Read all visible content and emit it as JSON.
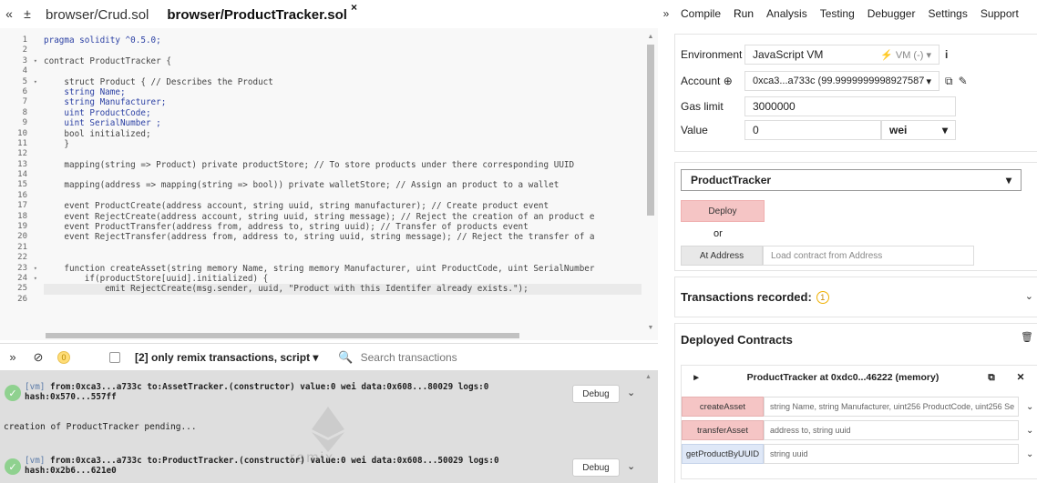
{
  "tabs": [
    {
      "label": "browser/Crud.sol"
    },
    {
      "label": "browser/ProductTracker.sol",
      "close": "×"
    }
  ],
  "nav_icons": {
    "left": "«",
    "add": "±"
  },
  "editor": {
    "lines": [
      {
        "n": "1",
        "fold": "",
        "text": "pragma solidity ^0.5.0;",
        "cls": "kw"
      },
      {
        "n": "2",
        "fold": "",
        "text": "",
        "cls": ""
      },
      {
        "n": "3",
        "fold": "▾",
        "text": "contract ProductTracker {",
        "cls": ""
      },
      {
        "n": "4",
        "fold": "",
        "text": "",
        "cls": ""
      },
      {
        "n": "5",
        "fold": "▾",
        "text": "    struct Product { // Describes the Product",
        "cls": ""
      },
      {
        "n": "6",
        "fold": "",
        "text": "    string Name;",
        "cls": "kw"
      },
      {
        "n": "7",
        "fold": "",
        "text": "    string Manufacturer;",
        "cls": "kw"
      },
      {
        "n": "8",
        "fold": "",
        "text": "    uint ProductCode;",
        "cls": "kw"
      },
      {
        "n": "9",
        "fold": "",
        "text": "    uint SerialNumber ;",
        "cls": "kw"
      },
      {
        "n": "10",
        "fold": "",
        "text": "    bool initialized;",
        "cls": ""
      },
      {
        "n": "11",
        "fold": "",
        "text": "    }",
        "cls": ""
      },
      {
        "n": "12",
        "fold": "",
        "text": "",
        "cls": ""
      },
      {
        "n": "13",
        "fold": "",
        "text": "    mapping(string => Product) private productStore; // To store products under there corresponding UUID",
        "cls": ""
      },
      {
        "n": "14",
        "fold": "",
        "text": "",
        "cls": ""
      },
      {
        "n": "15",
        "fold": "",
        "text": "    mapping(address => mapping(string => bool)) private walletStore; // Assign an product to a wallet",
        "cls": ""
      },
      {
        "n": "16",
        "fold": "",
        "text": "",
        "cls": ""
      },
      {
        "n": "17",
        "fold": "",
        "text": "    event ProductCreate(address account, string uuid, string manufacturer); // Create product event",
        "cls": ""
      },
      {
        "n": "18",
        "fold": "",
        "text": "    event RejectCreate(address account, string uuid, string message); // Reject the creation of an product e",
        "cls": ""
      },
      {
        "n": "19",
        "fold": "",
        "text": "    event ProductTransfer(address from, address to, string uuid); // Transfer of products event",
        "cls": ""
      },
      {
        "n": "20",
        "fold": "",
        "text": "    event RejectTransfer(address from, address to, string uuid, string message); // Reject the transfer of a",
        "cls": ""
      },
      {
        "n": "21",
        "fold": "",
        "text": "",
        "cls": ""
      },
      {
        "n": "22",
        "fold": "",
        "text": "",
        "cls": ""
      },
      {
        "n": "23",
        "fold": "▾",
        "text": "    function createAsset(string memory Name, string memory Manufacturer, uint ProductCode, uint SerialNumber",
        "cls": ""
      },
      {
        "n": "24",
        "fold": "▾",
        "text": "        if(productStore[uuid].initialized) {",
        "cls": ""
      },
      {
        "n": "25",
        "fold": "",
        "text": "            emit RejectCreate(msg.sender, uuid, \"Product with this Identifer already exists.\");",
        "cls": "caret"
      },
      {
        "n": "26",
        "fold": "",
        "text": "",
        "cls": ""
      }
    ]
  },
  "terminal_bar": {
    "collapse_icon": "chevron-double-down-icon",
    "clear_icon": "ban-icon",
    "pending_count": "0",
    "filter_label": "[2] only remix transactions, script",
    "search_placeholder": "Search transactions"
  },
  "terminal": {
    "tx1": {
      "tag": "[vm]",
      "line1": "from:0xca3...a733c to:AssetTracker.(constructor) value:0 wei data:0x608...80029 logs:0",
      "line2": "hash:0x570...557ff"
    },
    "pending": "creation of ProductTracker pending...",
    "tx2": {
      "tag": "[vm]",
      "line1": "from:0xca3...a733c to:ProductTracker.(constructor) value:0 wei data:0x608...50029 logs:0",
      "line2": "hash:0x2b6...621e0"
    },
    "debug_label": "Debug",
    "watermark": "remix"
  },
  "right_tabs": [
    "Compile",
    "Run",
    "Analysis",
    "Testing",
    "Debugger",
    "Settings",
    "Support"
  ],
  "run": {
    "environment_label": "Environment",
    "environment_value": "JavaScript VM",
    "vm_label": "VM (-)",
    "account_label": "Account",
    "account_value": "0xca3...a733c (99.9999999998927587",
    "gas_label": "Gas limit",
    "gas_value": "3000000",
    "value_label": "Value",
    "value_value": "0",
    "value_unit": "wei"
  },
  "deploy": {
    "contract": "ProductTracker",
    "deploy_label": "Deploy",
    "or_label": "or",
    "at_address_label": "At Address",
    "at_address_placeholder": "Load contract from Address"
  },
  "transactions": {
    "label": "Transactions recorded:",
    "count": "1"
  },
  "deployed": {
    "label": "Deployed Contracts",
    "instance": "ProductTracker at 0xdc0...46222 (memory)",
    "functions": [
      {
        "name": "createAsset",
        "params": "string Name, string Manufacturer, uint256 ProductCode, uint256 Se",
        "kind": "red"
      },
      {
        "name": "transferAsset",
        "params": "address to, string uuid",
        "kind": "red"
      },
      {
        "name": "getProductByUUID",
        "params": "string uuid",
        "kind": "blue"
      }
    ]
  }
}
